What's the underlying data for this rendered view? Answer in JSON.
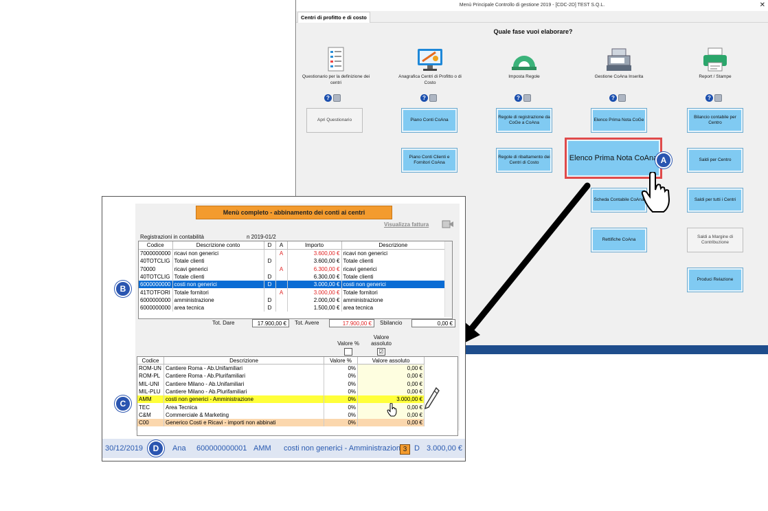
{
  "window": {
    "title": "Menù Principale Controllo di gestione 2019 - [CDC-2D] TEST S.Q.L.",
    "close": "✕",
    "tab": "Centri di profitto e di costo",
    "question": "Quale fase vuoi elaborare?"
  },
  "columns": [
    {
      "label": "Questionario per la definizione dei centri",
      "icon": "questionnaire-icon"
    },
    {
      "label": "Anagrafica Centri di Profitto o di Costo",
      "icon": "cost-center-registry-icon"
    },
    {
      "label": "Imposta Regole",
      "icon": "rules-icon"
    },
    {
      "label": "Gestione CoAna Inserita",
      "icon": "cash-register-icon"
    },
    {
      "label": "Report / Stampe",
      "icon": "printer-icon"
    }
  ],
  "help_glyph": "?",
  "buttons": {
    "apri_questionario": "Apri Questionario",
    "piano_conti_coana": "Piano Conti CoAna",
    "piano_conti_clienti": "Piano Conti Clienti e Fornitori CoAna",
    "regole_registrazione": "Regole di registrazione da CoGe a CoAna",
    "regole_ribaltamento": "Regole di ribaltamento dei Centri di Costo",
    "elenco_prima_nota_coge": "Elenco Prima Nota CoGe",
    "elenco_prima_nota_coana": "Elenco Prima Nota CoAna",
    "scheda_contabile": "Scheda Contabile CoAna",
    "rettifiche": "Rettifiche CoAna",
    "bilancio": "Bilancio contabile per Centro",
    "saldi_centro": "Saldi per Centro",
    "saldi_tutti": "Saldi per tutti i Centri",
    "saldi_margine": "Saldi a Margine di Contribuzione",
    "produci_relazione": "Produci Relazione"
  },
  "markers": {
    "a": "A",
    "b": "B",
    "c": "C",
    "d": "D"
  },
  "inset": {
    "title": "Menù completo - abbinamento dei conti ai centri",
    "visualizza": "Visualizza fattura",
    "reg_label": "Registrazioni in contabilità",
    "reg_num": "n 2019-01/2",
    "t1_headers": [
      "Codice",
      "Descrizione conto",
      "D",
      "A",
      "Importo",
      "Descrizione"
    ],
    "t1_rows": [
      {
        "codice": "7000000000",
        "desc": "ricavi non generici",
        "d": "",
        "a": "A",
        "importo": "3.600,00 €",
        "descr2": "ricavi non generici"
      },
      {
        "codice": "40TOTCLIG",
        "desc": "Totale clienti",
        "d": "D",
        "a": "",
        "importo": "3.600,00 €",
        "descr2": "Totale clienti"
      },
      {
        "codice": "70000",
        "desc": "ricavi generici",
        "d": "",
        "a": "A",
        "importo": "6.300,00 €",
        "descr2": "ricavi generici"
      },
      {
        "codice": "40TOTCLIG",
        "desc": "Totale clienti",
        "d": "D",
        "a": "",
        "importo": "6.300,00 €",
        "descr2": "Totale clienti"
      },
      {
        "codice": "6000000000",
        "desc": "costi non generici",
        "d": "D",
        "a": "",
        "importo": "3.000,00 €",
        "descr2": "costi non generici"
      },
      {
        "codice": "41TOTFORI",
        "desc": "Totale fornitori",
        "d": "",
        "a": "A",
        "importo": "3.000,00 €",
        "descr2": "Totale fornitori"
      },
      {
        "codice": "6000000000",
        "desc": "amministrazione",
        "d": "D",
        "a": "",
        "importo": "2.000,00 €",
        "descr2": "amministrazione"
      },
      {
        "codice": "6000000000",
        "desc": "area tecnica",
        "d": "D",
        "a": "",
        "importo": "1.500,00 €",
        "descr2": "area tecnica"
      }
    ],
    "tot_dare_label": "Tot. Dare",
    "tot_dare": "17.900,00 €",
    "tot_avere_label": "Tot. Avere",
    "tot_avere": "17.900,00 €",
    "sbilancio_label": "Sbilancio",
    "sbilancio": "0,00 €",
    "valore_pct_label": "Valore %",
    "valore_abs_label": "Valore assoluto",
    "valore_pct_checked": "",
    "valore_abs_checked": "☑",
    "t2_headers": [
      "Codice",
      "Descrizione",
      "Valore %",
      "Valore assoluto"
    ],
    "t2_rows": [
      {
        "codice": "ROM-UN",
        "desc": "Cantiere Roma - Ab.Unifamiliari",
        "pct": "0%",
        "abs": "0,00 €"
      },
      {
        "codice": "ROM-PL",
        "desc": "Cantiere Roma - Ab.Plurifamiliari",
        "pct": "0%",
        "abs": "0,00 €"
      },
      {
        "codice": "MIL-UNI",
        "desc": "Cantiere Milano - Ab.Unifamiliari",
        "pct": "0%",
        "abs": "0,00 €"
      },
      {
        "codice": "MIL-PLU",
        "desc": "Cantiere Milano - Ab.Plurifamiliari",
        "pct": "0%",
        "abs": "0,00 €"
      },
      {
        "codice": "AMM",
        "desc": "costi non generici - Amministrazione",
        "pct": "0%",
        "abs": "3.000,00 €"
      },
      {
        "codice": "TEC",
        "desc": "Area Tecnica",
        "pct": "0%",
        "abs": "0,00 €"
      },
      {
        "codice": "C&M",
        "desc": "Commerciale & Marketing",
        "pct": "0%",
        "abs": "0,00 €"
      },
      {
        "codice": "C00",
        "desc": "Generico Costi e Ricavi - importi non abbinati",
        "pct": "0%",
        "abs": "0,00 €"
      }
    ],
    "status": {
      "date": "30/12/2019",
      "type": "Ana",
      "account": "600000000001",
      "code": "AMM",
      "desc": "costi non generici - Amministrazione",
      "num": "3",
      "da": "D",
      "amount": "3.000,00 €"
    }
  }
}
